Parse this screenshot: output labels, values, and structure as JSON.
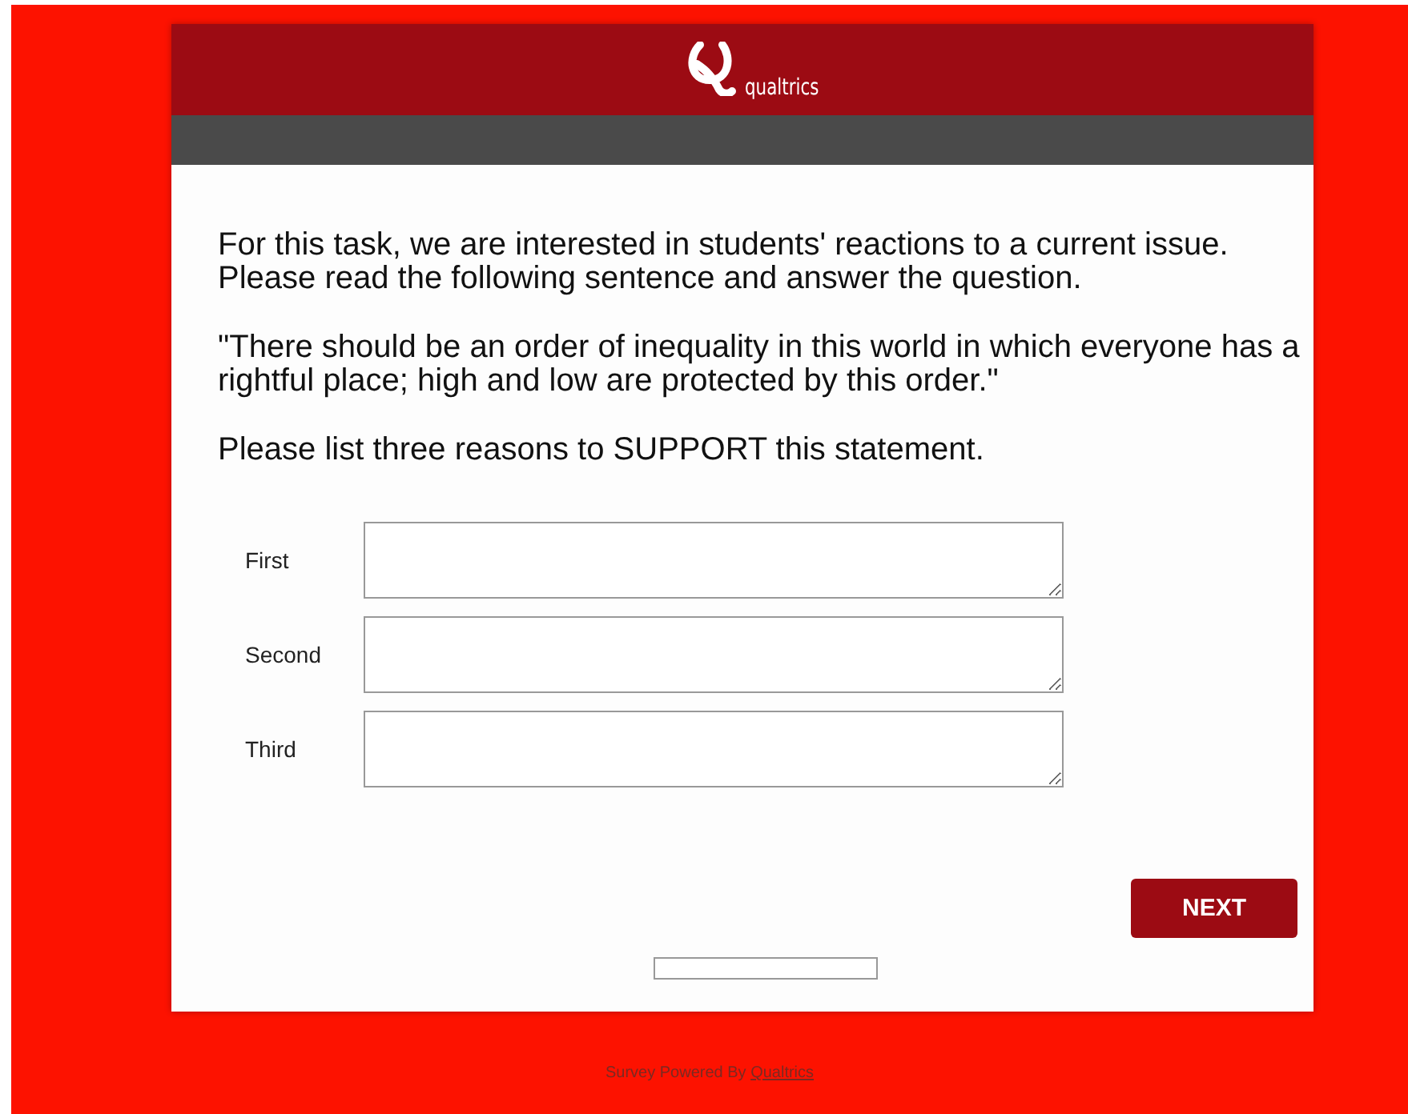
{
  "header": {
    "logo_text": "qualtrics"
  },
  "question": {
    "paragraphs": [
      "For this task, we are interested in students' reactions to a current issue. Please read the following sentence and answer the question.",
      "\"There should be an order of inequality in this world in which everyone has a rightful place; high and low are protected by this order.\"",
      "Please list three reasons to SUPPORT this statement."
    ]
  },
  "fields": [
    {
      "label": "First"
    },
    {
      "label": "Second"
    },
    {
      "label": "Third"
    }
  ],
  "next_button": "NEXT",
  "progress": {
    "level": 0
  },
  "footer": {
    "text": "Survey Powered By ",
    "link": "Qualtrics"
  }
}
